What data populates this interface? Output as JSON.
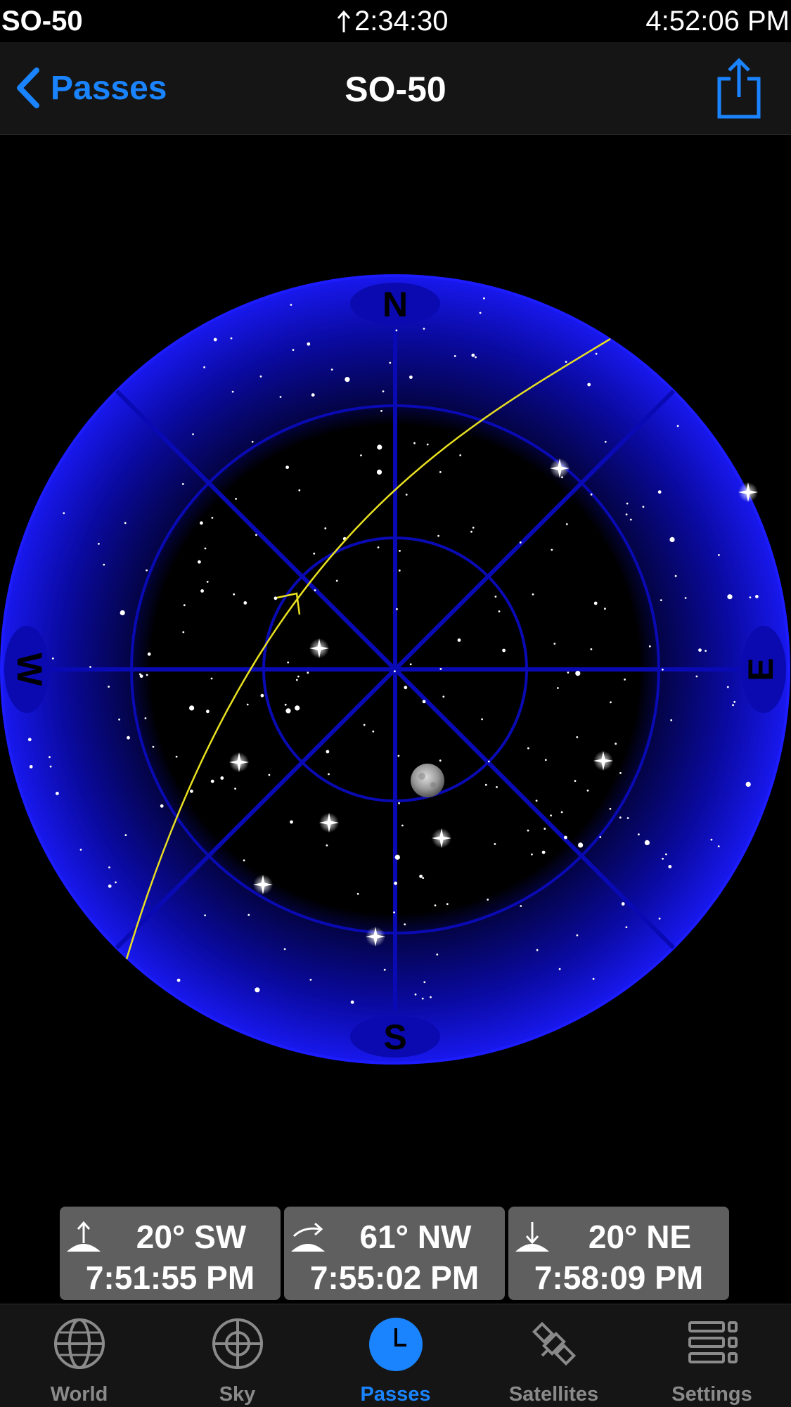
{
  "status": {
    "satellite": "SO-50",
    "countdown": "2:34:30",
    "clock": "4:52:06 PM"
  },
  "nav": {
    "back_label": "Passes",
    "title": "SO-50"
  },
  "compass": {
    "north": "N",
    "south": "S",
    "east": "E",
    "west": "W"
  },
  "colors": {
    "accent": "#1a84ff",
    "dome": "#1010ff",
    "track": "#e8e020"
  },
  "pass": [
    {
      "icon": "rise-icon",
      "direction": "20° SW",
      "time": "7:51:55 PM"
    },
    {
      "icon": "max-elevation-icon",
      "direction": "61° NW",
      "time": "7:55:02 PM"
    },
    {
      "icon": "set-icon",
      "direction": "20° NE",
      "time": "7:58:09 PM"
    }
  ],
  "tabs": [
    {
      "label": "World",
      "icon": "globe-icon"
    },
    {
      "label": "Sky",
      "icon": "crosshair-icon"
    },
    {
      "label": "Passes",
      "icon": "clock-icon",
      "active": true
    },
    {
      "label": "Satellites",
      "icon": "satellite-icon"
    },
    {
      "label": "Settings",
      "icon": "list-settings-icon"
    }
  ]
}
